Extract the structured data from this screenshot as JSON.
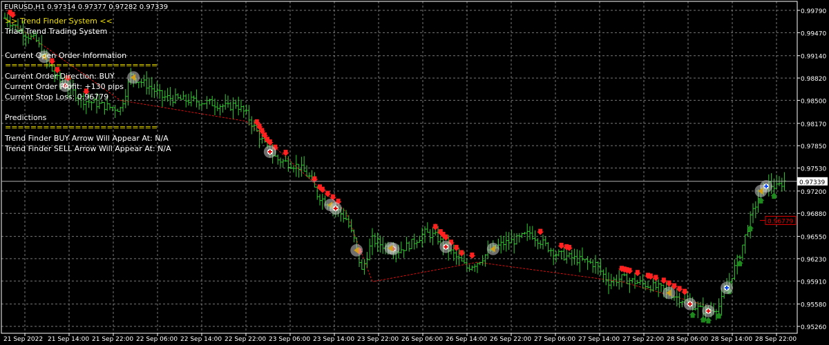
{
  "header": {
    "symbol_line": "EURUSD,H1  0.97314 0.97377 0.97282 0.97339"
  },
  "panel": {
    "system_name": ">> Trend Finder System <<",
    "subtitle": "Triad Trend Trading System",
    "order_heading": "Current Open Order Information",
    "separator": "========================",
    "direction": "Current Order Direction: BUY",
    "profit": "Current Order Profit: +130 pips",
    "stop_loss": "Current Stop Loss: 0.96779",
    "predictions_heading": "Predictions",
    "buy_prediction": "Trend Finder BUY Arrow Will Appear At: N/A",
    "sell_prediction": "Trend Finder SELL Arrow Will Appear At: N/A"
  },
  "colors": {
    "background": "#000000",
    "grid": "#7a7a7a",
    "candle": "#33cc33",
    "sell_arrow": "#ff2020",
    "buy_arrow": "#1e8a1e",
    "trend_line": "#e01010",
    "text": "#ffffff",
    "accent_text": "#f0e000"
  },
  "chart_data": {
    "type": "bar",
    "symbol": "EURUSD",
    "timeframe": "H1",
    "ohlc_last": {
      "open": 0.97314,
      "high": 0.97377,
      "low": 0.97282,
      "close": 0.97339
    },
    "current_price_label": "0.97339",
    "stop_loss_label": "0.96779",
    "ylim": [
      0.9526,
      0.9979
    ],
    "y_ticks": [
      "0.99790",
      "0.99470",
      "0.99140",
      "0.98820",
      "0.98500",
      "0.98170",
      "0.97850",
      "0.97530",
      "0.97200",
      "0.96880",
      "0.96550",
      "0.96230",
      "0.95910",
      "0.95580",
      "0.95260"
    ],
    "x_ticks": [
      "21 Sep 2022",
      "21 Sep 14:00",
      "21 Sep 22:00",
      "22 Sep 06:00",
      "22 Sep 14:00",
      "22 Sep 22:00",
      "23 Sep 06:00",
      "23 Sep 14:00",
      "23 Sep 22:00",
      "26 Sep 06:00",
      "26 Sep 14:00",
      "26 Sep 22:00",
      "27 Sep 06:00",
      "27 Sep 14:00",
      "27 Sep 22:00",
      "28 Sep 06:00",
      "28 Sep 14:00",
      "28 Sep 22:00"
    ],
    "grid": true,
    "price_path": [
      [
        0,
        0.9968
      ],
      [
        6,
        0.995
      ],
      [
        12,
        0.9935
      ],
      [
        16,
        0.9905
      ],
      [
        20,
        0.988
      ],
      [
        25,
        0.9865
      ],
      [
        30,
        0.985
      ],
      [
        35,
        0.9845
      ],
      [
        40,
        0.984
      ],
      [
        44,
        0.9838
      ],
      [
        48,
        0.9885
      ],
      [
        55,
        0.987
      ],
      [
        60,
        0.9855
      ],
      [
        65,
        0.9852
      ],
      [
        70,
        0.985
      ],
      [
        75,
        0.9848
      ],
      [
        80,
        0.9845
      ],
      [
        85,
        0.984
      ],
      [
        88,
        0.9845
      ],
      [
        92,
        0.983
      ],
      [
        96,
        0.9805
      ],
      [
        100,
        0.978
      ],
      [
        104,
        0.9765
      ],
      [
        108,
        0.976
      ],
      [
        112,
        0.9755
      ],
      [
        116,
        0.974
      ],
      [
        119,
        0.9715
      ],
      [
        122,
        0.9705
      ],
      [
        126,
        0.9695
      ],
      [
        130,
        0.968
      ],
      [
        133,
        0.965
      ],
      [
        136,
        0.9605
      ],
      [
        140,
        0.965
      ],
      [
        145,
        0.964
      ],
      [
        150,
        0.9635
      ],
      [
        155,
        0.9645
      ],
      [
        160,
        0.966
      ],
      [
        164,
        0.9655
      ],
      [
        168,
        0.964
      ],
      [
        172,
        0.9625
      ],
      [
        176,
        0.961
      ],
      [
        180,
        0.9618
      ],
      [
        185,
        0.9635
      ],
      [
        190,
        0.9645
      ],
      [
        195,
        0.965
      ],
      [
        200,
        0.966
      ],
      [
        205,
        0.9645
      ],
      [
        210,
        0.963
      ],
      [
        215,
        0.9625
      ],
      [
        220,
        0.962
      ],
      [
        225,
        0.9615
      ],
      [
        230,
        0.959
      ],
      [
        235,
        0.9595
      ],
      [
        240,
        0.959
      ],
      [
        245,
        0.9585
      ],
      [
        250,
        0.958
      ],
      [
        255,
        0.957
      ],
      [
        260,
        0.956
      ],
      [
        265,
        0.955
      ],
      [
        268,
        0.9548
      ],
      [
        272,
        0.9555
      ],
      [
        276,
        0.959
      ],
      [
        280,
        0.963
      ],
      [
        284,
        0.968
      ],
      [
        288,
        0.972
      ],
      [
        291,
        0.973
      ],
      [
        294,
        0.9725
      ],
      [
        297,
        0.9734
      ]
    ],
    "sell_arrows": [
      2,
      3,
      18,
      20,
      24,
      31,
      96,
      97,
      98,
      99,
      100,
      101,
      103,
      107,
      118,
      120,
      121,
      123,
      125,
      127,
      135,
      164,
      166,
      167,
      168,
      170,
      172,
      174,
      178,
      204,
      212,
      214,
      215,
      235,
      236,
      237,
      238,
      241,
      245,
      246,
      248,
      251,
      253,
      255,
      257,
      259
    ],
    "buy_arrows": [
      262,
      266,
      268,
      272,
      276,
      280,
      284,
      288,
      293
    ]
  }
}
